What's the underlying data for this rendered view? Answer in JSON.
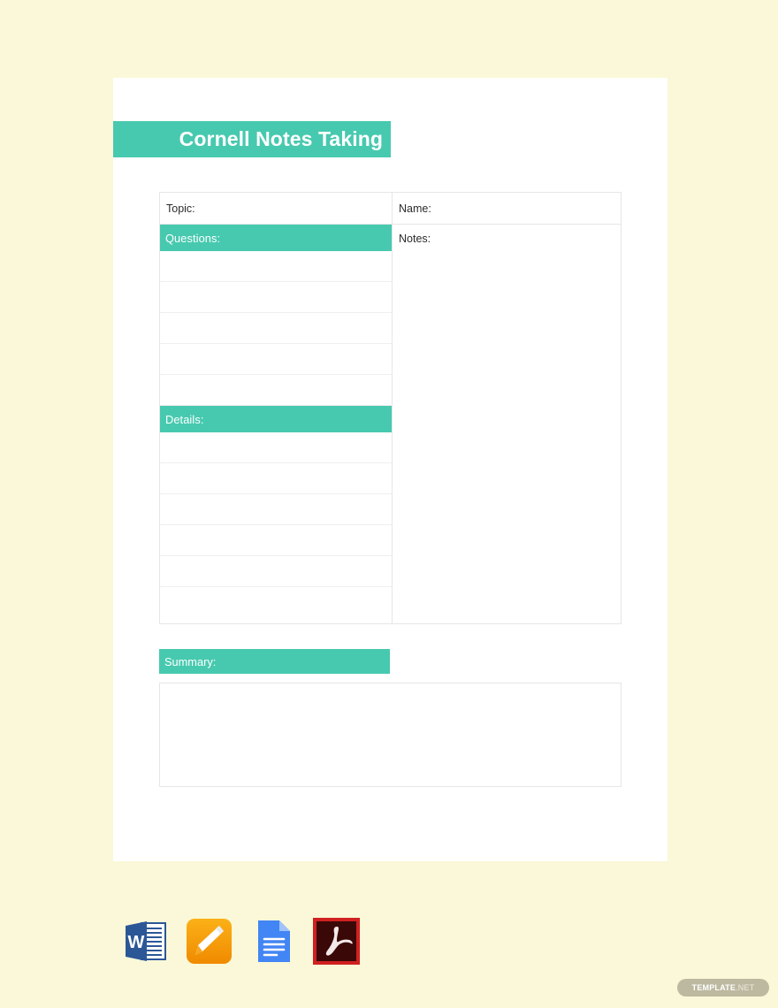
{
  "document": {
    "title": "Cornell Notes Taking",
    "background_color": "#FAF8D8",
    "page_color": "#FFFFFF",
    "accent_color": "#47C9AF"
  },
  "table": {
    "header": {
      "topic_label": "Topic:",
      "name_label": "Name:"
    },
    "sections": [
      {
        "id": "questions",
        "band_label": "Questions:",
        "blank_rows": 5
      },
      {
        "id": "details",
        "band_label": "Details:",
        "blank_rows": 6
      }
    ],
    "notes_label": "Notes:"
  },
  "summary": {
    "band_label": "Summary:",
    "box_value": ""
  },
  "formats": [
    {
      "name": "ms-word-icon",
      "label": "MS Word"
    },
    {
      "name": "apple-pages-icon",
      "label": "Apple Pages"
    },
    {
      "name": "google-docs-icon",
      "label": "Google Docs"
    },
    {
      "name": "pdf-icon",
      "label": "PDF"
    }
  ],
  "watermark": {
    "primary": "TEMPLATE",
    "secondary": ".NET"
  }
}
